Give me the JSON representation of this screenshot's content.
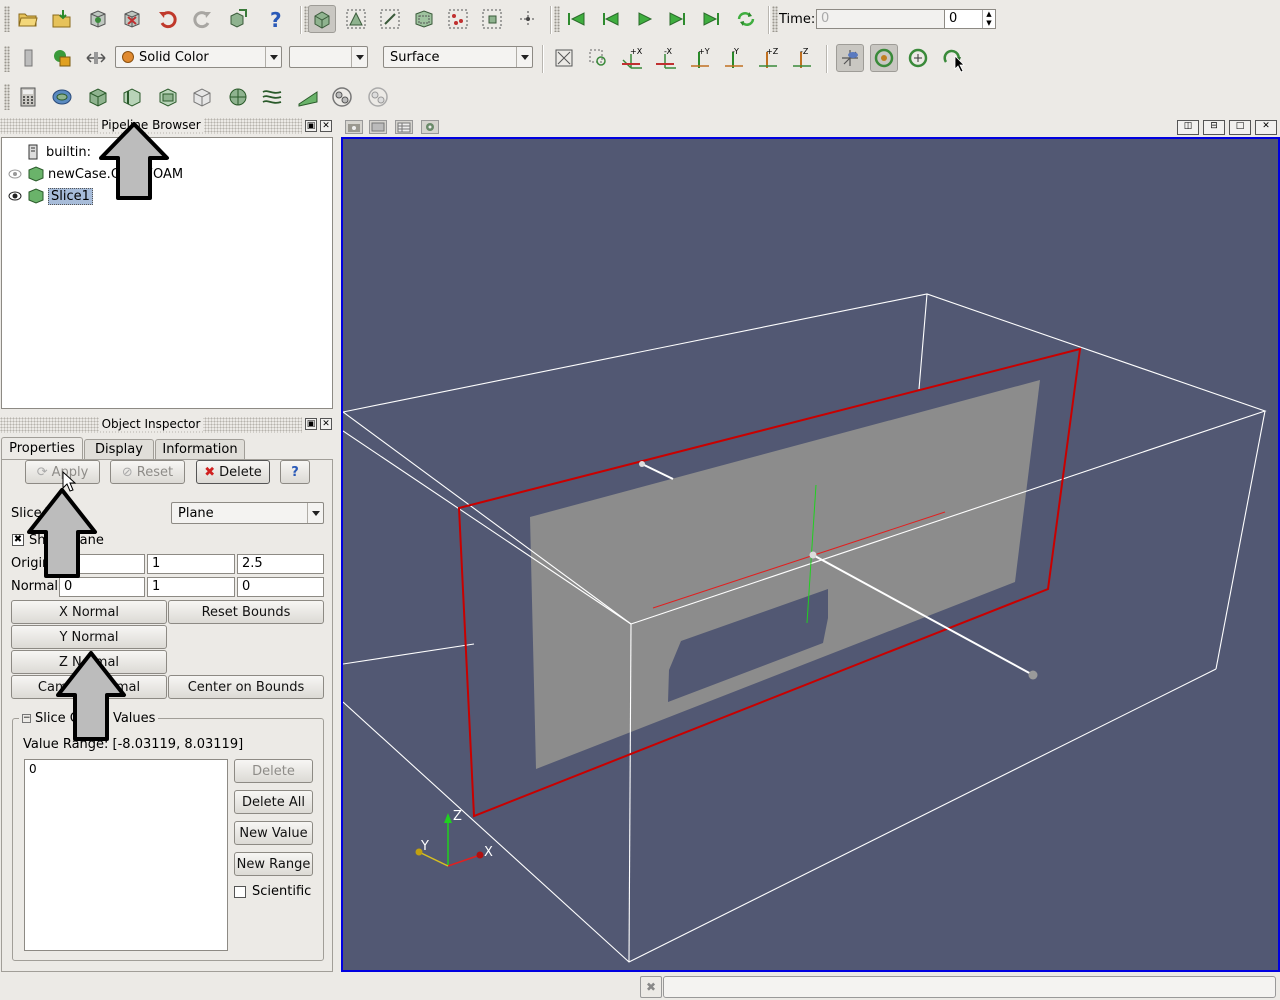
{
  "toolbar": {
    "time_label": "Time:",
    "time_value": "0",
    "time_step": "0",
    "coloring": "Solid Color",
    "component": "",
    "representation": "Surface"
  },
  "pipeline_browser": {
    "title": "Pipeline Browser",
    "items": [
      {
        "label": "builtin:"
      },
      {
        "label": "newCase.OpenFOAM"
      },
      {
        "label": "Slice1"
      }
    ]
  },
  "object_inspector": {
    "title": "Object Inspector",
    "tabs": [
      "Properties",
      "Display",
      "Information"
    ],
    "apply": "Apply",
    "reset": "Reset",
    "delete": "Delete",
    "help": "?",
    "slice_type_label": "Slice Type",
    "slice_type": "Plane",
    "show_plane": "Show Plane",
    "origin_label": "Origin",
    "origin": [
      "0",
      "1",
      "2.5"
    ],
    "normal_label": "Normal",
    "normal": [
      "0",
      "1",
      "0"
    ],
    "x_normal": "X Normal",
    "y_normal": "Y Normal",
    "z_normal": "Z Normal",
    "camera_normal": "Camera Normal",
    "reset_bounds": "Reset Bounds",
    "center_on_bounds": "Center on Bounds",
    "offset_group": "Slice Offset Values",
    "value_range": "Value Range: [-8.03119, 8.03119]",
    "values": [
      "0"
    ],
    "delete_value": "Delete",
    "delete_all": "Delete All",
    "new_value": "New Value",
    "new_range": "New Range",
    "scientific": "Scientific"
  },
  "viewport": {
    "background": "#525873",
    "axis_x": "X",
    "axis_y": "Y",
    "axis_z": "Z"
  },
  "colors": {
    "selection": "#a7bcd9",
    "plane_outline": "#c80000",
    "slice_surface": "#8c8c8c"
  }
}
